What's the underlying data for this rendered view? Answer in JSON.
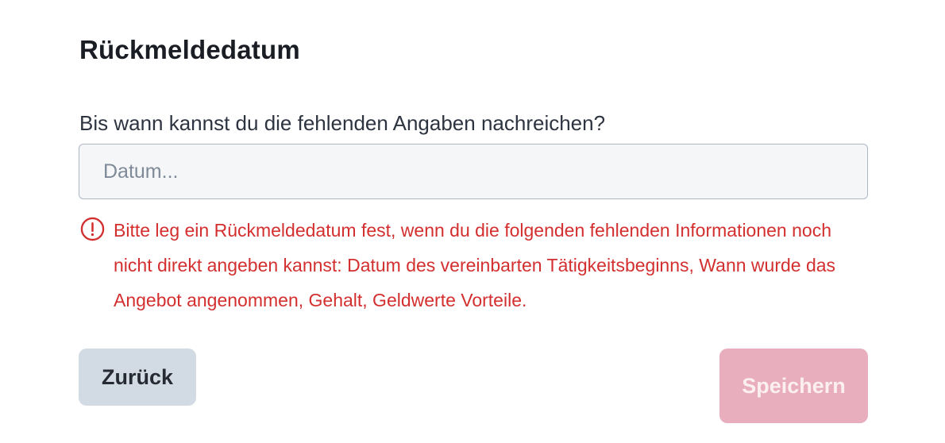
{
  "dialog": {
    "title": "Rückmeldedatum"
  },
  "date_field": {
    "label": "Bis wann kannst du die fehlenden Angaben nachreichen?",
    "placeholder": "Datum...",
    "value": ""
  },
  "error": {
    "icon": "alert-circle-icon",
    "message": "Bitte leg ein Rückmeldedatum fest, wenn du die folgenden fehlenden Informationen noch nicht direkt angeben kannst: Datum des vereinbarten Tätigkeitsbeginns, Wann wurde das Angebot angenommen, Gehalt, Geldwerte Vorteile.",
    "color": "#d32f2f"
  },
  "actions": {
    "back_label": "Zurück",
    "save_label": "Speichern",
    "save_disabled": true,
    "save_color": "#e8aebd"
  }
}
